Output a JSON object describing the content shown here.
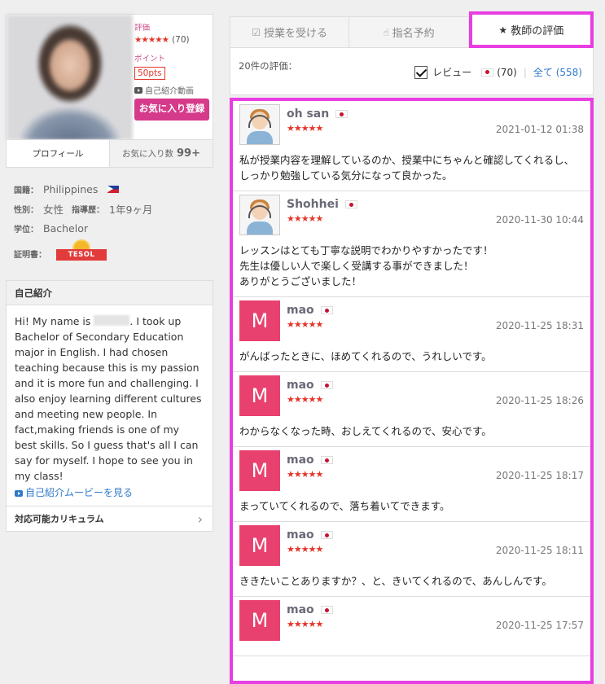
{
  "profile": {
    "rating_label": "評価",
    "stars": "★★★★★",
    "rating_count": "(70)",
    "points_label": "ポイント",
    "points": "50pts",
    "video_label": "自己紹介動画",
    "favorite_button": "お気に入り登録",
    "tab_profile": "プロフィール",
    "tab_favorites": "お気に入り数",
    "favorites_count": "99+"
  },
  "info": {
    "nationality_label": "国籍：",
    "nationality": "Philippines",
    "gender_label": "性別：",
    "gender": "女性",
    "experience_label": "指導歴：",
    "experience": "1年9ヶ月",
    "degree_label": "学位：",
    "degree": "Bachelor",
    "cert_label": "証明書：",
    "cert_badge": "TESOL"
  },
  "intro": {
    "title": "自己紹介",
    "text_before": "Hi! My name is ",
    "text_after": ". I took up Bachelor of Secondary Education major in English. I had chosen teaching because this is my passion and it is more fun and challenging. I also enjoy learning different cultures and meeting new people. In fact,making friends is one of my best skills. So I guess that's all I can say for myself. I hope to see you in my class!",
    "movie_link": "自己紹介ムービーを見る",
    "curriculum": "対応可能カリキュラム"
  },
  "tabs": {
    "take_lesson": "授業を受ける",
    "reserve": "指名予約",
    "reviews": "教師の評価"
  },
  "summary": {
    "count": "20件の評価：",
    "review_label": "レビュー",
    "jp_count": "(70)",
    "all_label": "全て",
    "all_count": "(558)"
  },
  "reviews": [
    {
      "avatar": "pic",
      "initial": "",
      "name": "oh san",
      "stars": "★★★★★",
      "date": "2021-01-12 01:38",
      "text": "私が授業内容を理解しているのか、授業中にちゃんと確認してくれるし、\nしっかり勉強している気分になって良かった。"
    },
    {
      "avatar": "pic",
      "initial": "",
      "name": "Shohhei",
      "stars": "★★★★★",
      "date": "2020-11-30 10:44",
      "text": "レッスンはとても丁寧な説明でわかりやすかったです！\n先生は優しい人で楽しく受講する事ができました！\nありがとうございました！"
    },
    {
      "avatar": "m",
      "initial": "M",
      "name": "mao",
      "stars": "★★★★★",
      "date": "2020-11-25 18:31",
      "text": "がんばったときに、ほめてくれるので、うれしいです。"
    },
    {
      "avatar": "m",
      "initial": "M",
      "name": "mao",
      "stars": "★★★★★",
      "date": "2020-11-25 18:26",
      "text": "わからなくなった時、おしえてくれるので、安心です。"
    },
    {
      "avatar": "m",
      "initial": "M",
      "name": "mao",
      "stars": "★★★★★",
      "date": "2020-11-25 18:17",
      "text": "まっていてくれるので、落ち着いてできます。"
    },
    {
      "avatar": "m",
      "initial": "M",
      "name": "mao",
      "stars": "★★★★★",
      "date": "2020-11-25 18:11",
      "text": "ききたいことありますか？、と、きいてくれるので、あんしんです。"
    },
    {
      "avatar": "m",
      "initial": "M",
      "name": "mao",
      "stars": "★★★★★",
      "date": "2020-11-25 17:57",
      "text": ""
    }
  ]
}
